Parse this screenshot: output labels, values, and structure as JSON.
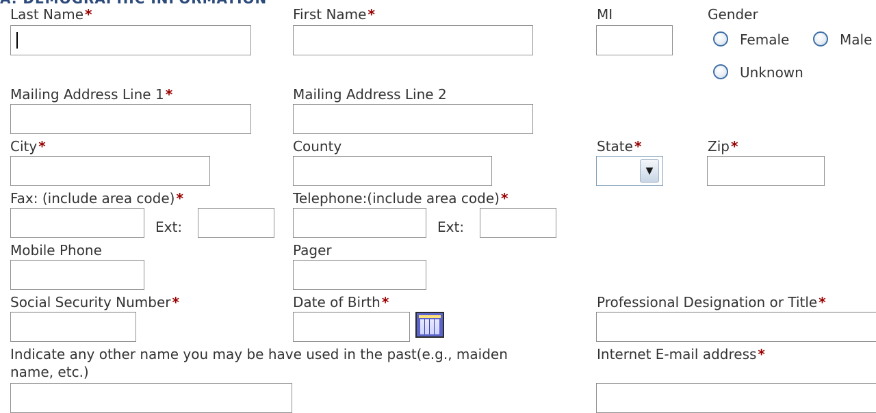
{
  "section": {
    "title": "A. DEMOGRAPHIC INFORMATION"
  },
  "required_mark": "*",
  "fields": {
    "last_name": {
      "label": "Last Name",
      "value": ""
    },
    "first_name": {
      "label": "First Name",
      "value": ""
    },
    "mi": {
      "label": "MI",
      "value": ""
    },
    "gender": {
      "label": "Gender",
      "options": [
        "Female",
        "Male",
        "Unknown"
      ],
      "selected": ""
    },
    "mailing1": {
      "label": "Mailing Address Line 1",
      "value": ""
    },
    "mailing2": {
      "label": "Mailing Address Line 2",
      "value": ""
    },
    "city": {
      "label": "City",
      "value": ""
    },
    "county": {
      "label": "County",
      "value": ""
    },
    "state": {
      "label": "State",
      "value": ""
    },
    "zip": {
      "label": "Zip",
      "value": ""
    },
    "fax": {
      "label": "Fax: (include area code)",
      "ext_label": "Ext:",
      "value": ""
    },
    "telephone": {
      "label": "Telephone:(include area code)",
      "ext_label": "Ext:",
      "value": ""
    },
    "mobile": {
      "label": "Mobile Phone",
      "value": ""
    },
    "pager": {
      "label": "Pager",
      "value": ""
    },
    "ssn": {
      "label": "Social Security Number",
      "value": ""
    },
    "dob": {
      "label": "Date of Birth",
      "value": "",
      "icon": "calendar-icon"
    },
    "prof_title": {
      "label": "Professional Designation or Title",
      "value": ""
    },
    "other_names": {
      "label_line1": "Indicate any other name you may be have used in the past(e.g., maiden",
      "label_line2": "name, etc.)",
      "value": ""
    },
    "email": {
      "label": "Internet E-mail address",
      "value": ""
    }
  },
  "colors": {
    "required": "#990000",
    "radio_border": "#3d6fa6",
    "input_border": "#8f8f8f"
  }
}
